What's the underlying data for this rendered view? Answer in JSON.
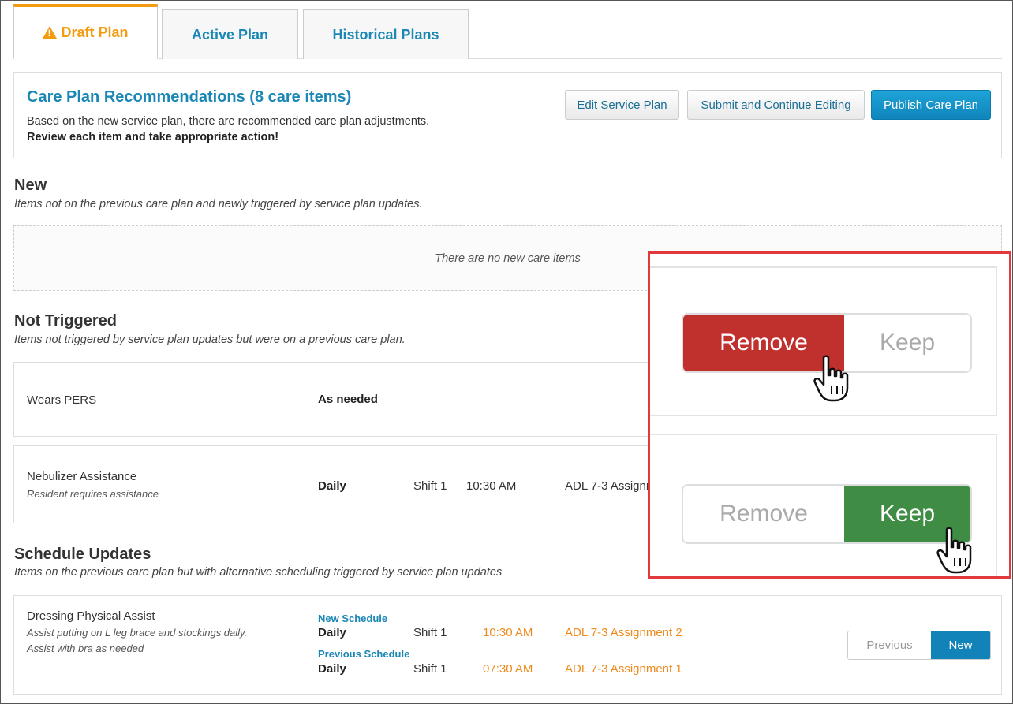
{
  "tabs": [
    {
      "label": "Draft Plan",
      "icon": "warning-icon",
      "active": true
    },
    {
      "label": "Active Plan",
      "active": false
    },
    {
      "label": "Historical Plans",
      "active": false
    }
  ],
  "recommendations": {
    "title": "Care Plan Recommendations (8 care items)",
    "description": "Based on the new service plan, there are recommended care plan adjustments.",
    "instruction": "Review each item and take appropriate action!",
    "buttons": {
      "edit": "Edit Service Plan",
      "submit": "Submit and Continue Editing",
      "publish": "Publish Care Plan"
    }
  },
  "sections": {
    "new": {
      "title": "New",
      "subtitle": "Items not on the previous care plan and newly triggered by service plan updates.",
      "empty_text": "There are no new care items"
    },
    "not_triggered": {
      "title": "Not Triggered",
      "subtitle": "Items not triggered by service plan updates but were on a previous care plan.",
      "items": [
        {
          "name": "Wears PERS",
          "note": "",
          "frequency": "As needed",
          "shift": "",
          "time": "",
          "assignment": ""
        },
        {
          "name": "Nebulizer Assistance",
          "note": "Resident requires assistance",
          "frequency": "Daily",
          "shift": "Shift 1",
          "time": "10:30 AM",
          "assignment": "ADL 7-3 Assignm"
        }
      ]
    },
    "schedule_updates": {
      "title": "Schedule Updates",
      "subtitle": "Items on the previous care plan but with alternative scheduling triggered by service plan updates",
      "items": [
        {
          "name": "Dressing Physical Assist",
          "notes": [
            "Assist putting on L leg brace and stockings daily.",
            "Assist with bra as needed"
          ],
          "new_schedule": {
            "label": "New Schedule",
            "frequency": "Daily",
            "shift": "Shift 1",
            "time": "10:30 AM",
            "assignment": "ADL 7-3 Assignment 2"
          },
          "previous_schedule": {
            "label": "Previous Schedule",
            "frequency": "Daily",
            "shift": "Shift 1",
            "time": "07:30 AM",
            "assignment": "ADL 7-3 Assignment 1"
          },
          "toggle": {
            "previous": "Previous",
            "new": "New",
            "selected": "new"
          }
        }
      ]
    }
  },
  "zoom_callout": {
    "top_toggle": {
      "remove": "Remove",
      "keep": "Keep",
      "selected": "remove"
    },
    "bottom_toggle": {
      "remove": "Remove",
      "keep": "Keep",
      "selected": "keep"
    },
    "highlight_color": "#e0393e"
  },
  "colors": {
    "accent_blue": "#1a87b5",
    "draft_orange": "#f39c12",
    "schedule_orange": "#ee8a1c",
    "remove_red": "#c0302d",
    "keep_green": "#3f8c45"
  }
}
